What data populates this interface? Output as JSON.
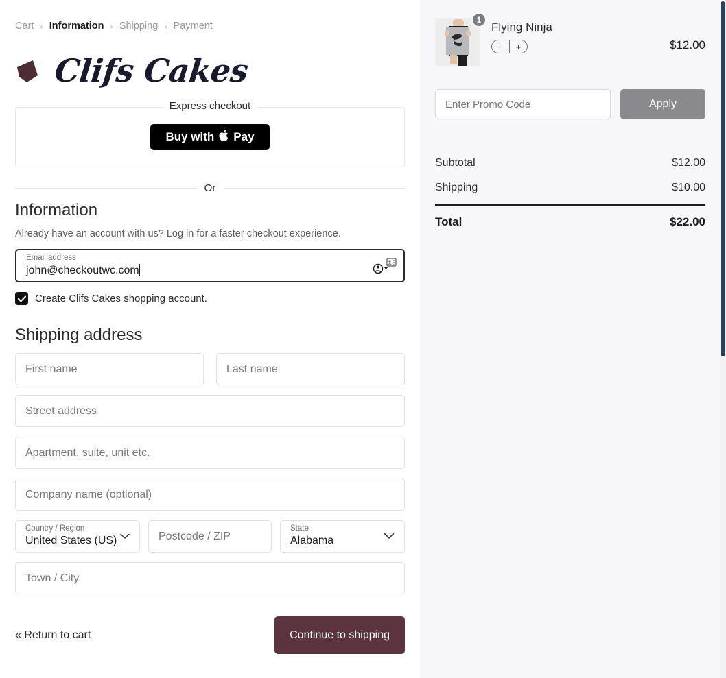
{
  "breadcrumb": {
    "separator": "›",
    "items": [
      {
        "label": "Cart",
        "current": false
      },
      {
        "label": "Information",
        "current": true
      },
      {
        "label": "Shipping",
        "current": false
      },
      {
        "label": "Payment",
        "current": false
      }
    ]
  },
  "brand": {
    "name": "Clifs Cakes",
    "logo_color": "#4d2c33",
    "text_color": "#1a1a2e"
  },
  "express": {
    "legend": "Express checkout",
    "apple_pay_label": "Buy with",
    "apple_glyph": "",
    "apple_pay_suffix": "Pay",
    "button_bg": "#000000"
  },
  "divider": {
    "or_label": "Or"
  },
  "information": {
    "title": "Information",
    "login_prompt": "Already have an account with us? Log in for a faster checkout experience.",
    "email": {
      "label": "Email address",
      "value": "john@checkoutwc.com",
      "focused": true
    },
    "create_account": {
      "label": "Create Clifs Cakes shopping account.",
      "checked": true
    }
  },
  "shipping": {
    "title": "Shipping address",
    "first_name_placeholder": "First name",
    "last_name_placeholder": "Last name",
    "street_placeholder": "Street address",
    "apartment_placeholder": "Apartment, suite, unit etc.",
    "company_placeholder": "Company name (optional)",
    "country": {
      "label": "Country / Region",
      "value": "United States (US)"
    },
    "postcode_placeholder": "Postcode / ZIP",
    "state": {
      "label": "State",
      "value": "Alabama"
    },
    "city_placeholder": "Town / City"
  },
  "actions": {
    "return_to_cart": "« Return to cart",
    "continue_label": "Continue to shipping",
    "continue_bg": "#5b3440"
  },
  "cart": {
    "item": {
      "name": "Flying Ninja",
      "price": "$12.00",
      "quantity_badge": "1",
      "decrease_label": "−",
      "increase_label": "+"
    },
    "promo": {
      "placeholder": "Enter Promo Code",
      "apply_label": "Apply",
      "apply_bg": "#8a8a8e"
    },
    "totals": [
      {
        "label": "Subtotal",
        "value": "$12.00",
        "grand": false
      },
      {
        "label": "Shipping",
        "value": "$10.00",
        "grand": false
      }
    ],
    "grand_total": {
      "label": "Total",
      "value": "$22.00"
    }
  }
}
